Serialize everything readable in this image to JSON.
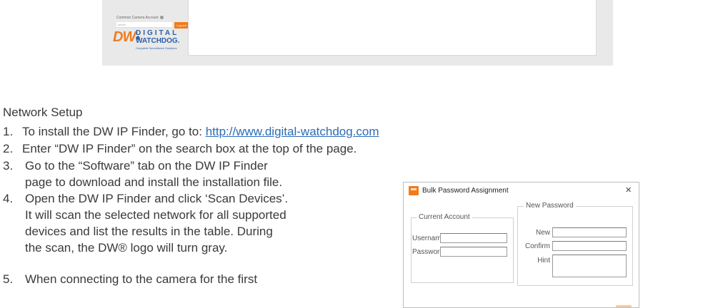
{
  "top_panel": {
    "camera_account_label": "Common Camera Account",
    "username_value": "admin",
    "logout_label": "Log out",
    "logo": {
      "mark": "DW",
      "word1": "DIGITAL",
      "word2": "WATCHDOG.",
      "tagline": "Complete Surveillance Solutions"
    }
  },
  "doc": {
    "section_title": "Network Setup",
    "steps": [
      {
        "num": "1.",
        "text": "To install the DW IP Finder, go to: ",
        "link": "http://www.digital-watchdog.com"
      },
      {
        "num": "2.",
        "text": "Enter “DW IP Finder” on the search box at the top of the page."
      },
      {
        "num": "3.",
        "lines": [
          "Go to the “Software” tab on the DW IP Finder",
          "page to download and install the installation file."
        ]
      },
      {
        "num": "4.",
        "lines": [
          "Open the DW IP Finder and click ‘Scan Devices’.",
          "It will scan the selected network for all supported",
          "devices and list the results in the table. During",
          "the scan, the DW® logo will turn gray."
        ]
      },
      {
        "num": "5.",
        "lines": [
          "When connecting to the camera for the first"
        ]
      }
    ]
  },
  "dialog": {
    "title": "Bulk Password Assignment",
    "close_glyph": "×",
    "current_account": {
      "legend": "Current Account",
      "username_label": "Username",
      "password_label": "Password"
    },
    "new_password": {
      "legend": "New Password",
      "new_label": "New",
      "confirm_label": "Confirm",
      "hint_label": "Hint"
    }
  },
  "colors": {
    "brand_orange": "#f07c1d",
    "brand_blue": "#2a5ea8",
    "link_blue": "#2b6cb6"
  }
}
